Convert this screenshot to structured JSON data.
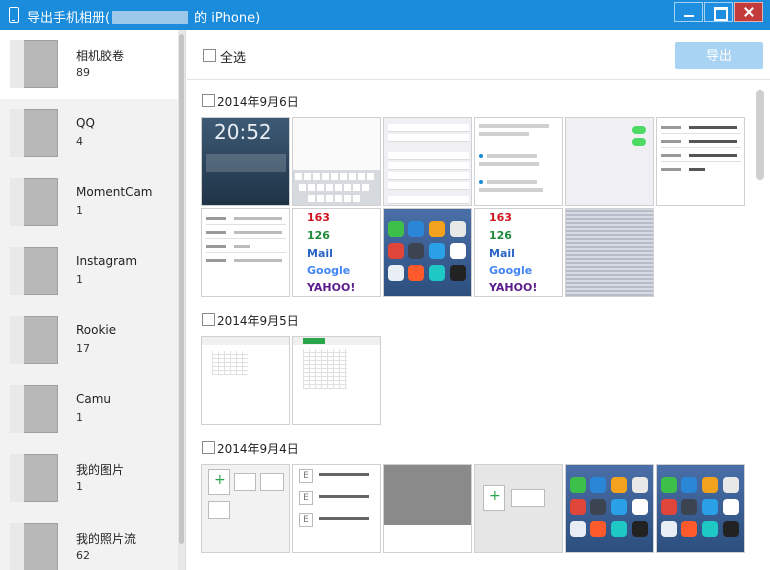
{
  "window": {
    "title_prefix": "导出手机相册(",
    "title_suffix": "的 iPhone)"
  },
  "toolbar": {
    "select_all": "全选",
    "export": "导出"
  },
  "albums": [
    {
      "name": "相机胶卷",
      "count": "89"
    },
    {
      "name": "QQ",
      "count": "4"
    },
    {
      "name": "MomentCam",
      "count": "1"
    },
    {
      "name": "Instagram",
      "count": "1"
    },
    {
      "name": "Rookie",
      "count": "17"
    },
    {
      "name": "Camu",
      "count": "1"
    },
    {
      "name": "我的图片",
      "count": "1"
    },
    {
      "name": "我的照片流",
      "count": "62"
    }
  ],
  "groups": [
    {
      "date": "2014年9月6日"
    },
    {
      "date": "2014年9月5日"
    },
    {
      "date": "2014年9月4日"
    }
  ],
  "photo_text": {
    "lock_time": "20:52",
    "logo_163": "163",
    "logo_126": "126",
    "logo_mail": "Mail",
    "logo_google": "Google",
    "logo_yahoo": "YAHOO!"
  },
  "colors": {
    "titlebar": "#1b8bdc",
    "export_button": "#a9d3f3",
    "sidebar": "#f2f2f2"
  }
}
